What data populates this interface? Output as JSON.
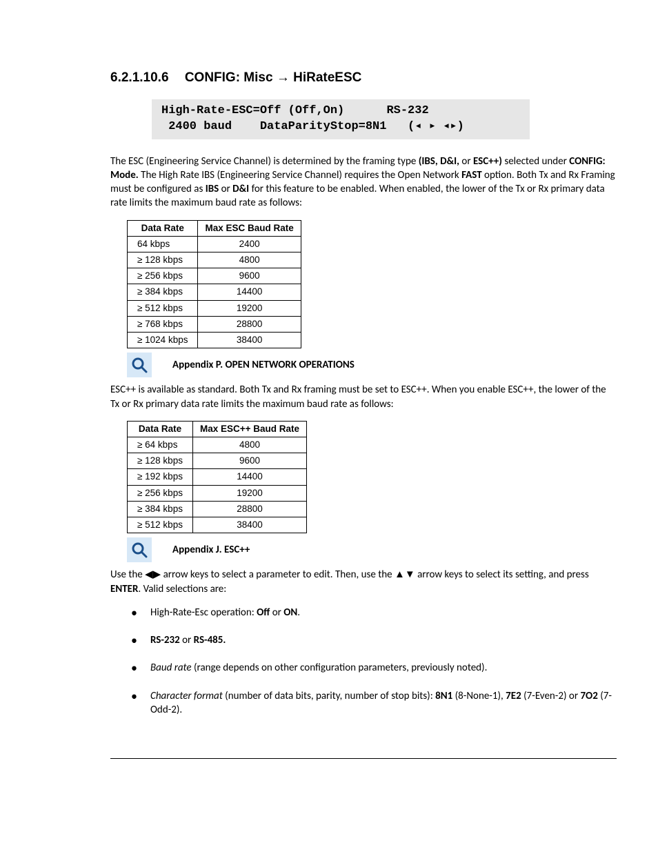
{
  "heading": {
    "number": "6.2.1.10.6",
    "title_prefix": "CONFIG: Misc ",
    "arrow": "→",
    "title_suffix": " HiRateESC"
  },
  "lcd": {
    "line1": "High-Rate-ESC=Off (Off,On)      RS-232",
    "line2": " 2400 baud    DataParityStop=8N1   (◂ ▸ ◂▸)"
  },
  "para1": {
    "t1": "The ESC (Engineering Service Channel) is determined by the framing type ",
    "b1": "(IBS, D&I,",
    "t2": " or ",
    "b2": "ESC++)",
    "t3": " selected under ",
    "b3": "CONFIG: Mode.",
    "t4": " The High Rate IBS (Engineering Service Channel) requires the Open Network ",
    "b4": "FAST",
    "t5": " option. Both Tx and Rx Framing must be configured as ",
    "b5": "IBS",
    "t6": " or ",
    "b6": "D&I",
    "t7": " for this feature to be enabled. When enabled, the lower of the Tx or Rx primary data rate limits the maximum baud rate as follows:"
  },
  "table1": {
    "h1": "Data Rate",
    "h2": "Max ESC Baud Rate",
    "rows": [
      {
        "c1": "64 kbps",
        "c2": "2400"
      },
      {
        "c1": "≥ 128 kbps",
        "c2": "4800"
      },
      {
        "c1": "≥ 256 kbps",
        "c2": "9600"
      },
      {
        "c1": "≥ 384 kbps",
        "c2": "14400"
      },
      {
        "c1": "≥ 512 kbps",
        "c2": "19200"
      },
      {
        "c1": "≥ 768 kbps",
        "c2": "28800"
      },
      {
        "c1": "≥ 1024 kbps",
        "c2": "38400"
      }
    ]
  },
  "appendixP": "Appendix P. OPEN NETWORK OPERATIONS",
  "para2": "ESC++ is available as standard. Both Tx and Rx framing must be set to ESC++. When you enable ESC++, the lower of the Tx or Rx primary data rate limits the maximum baud rate as follows:",
  "table2": {
    "h1": "Data Rate",
    "h2": "Max ESC++ Baud Rate",
    "rows": [
      {
        "c1": "≥ 64 kbps",
        "c2": "4800"
      },
      {
        "c1": "≥ 128 kbps",
        "c2": "9600"
      },
      {
        "c1": "≥ 192 kbps",
        "c2": "14400"
      },
      {
        "c1": "≥ 256 kbps",
        "c2": "19200"
      },
      {
        "c1": "≥ 384 kbps",
        "c2": "28800"
      },
      {
        "c1": "≥ 512 kbps",
        "c2": "38400"
      }
    ]
  },
  "appendixJ": "Appendix J. ESC++",
  "para3": {
    "t1": "Use the ◀▶ arrow keys to select a parameter to edit. Then, use the ▲▼ arrow keys to select its setting, and press ",
    "b1": "ENTER",
    "t2": ". Valid selections are:"
  },
  "bullets": {
    "b1": {
      "t1": "High-Rate-Esc operation: ",
      "b1": "Off",
      "t2": " or  ",
      "b2": "ON",
      "t3": "."
    },
    "b2": {
      "b1": "RS-232",
      "t1": " or ",
      "b2": "RS-485."
    },
    "b3": {
      "i1": "Baud rate",
      "t1": " (range depends on other configuration parameters, previously noted)."
    },
    "b4": {
      "i1": "Character format",
      "t1": " (number of data bits, parity, number of stop bits): ",
      "b1": "8N1",
      "t2": " (8-None-1), ",
      "b2": "7E2",
      "t3": " (7-Even-2) or ",
      "b3": "7O2",
      "t4": " (7-Odd-2)."
    }
  }
}
